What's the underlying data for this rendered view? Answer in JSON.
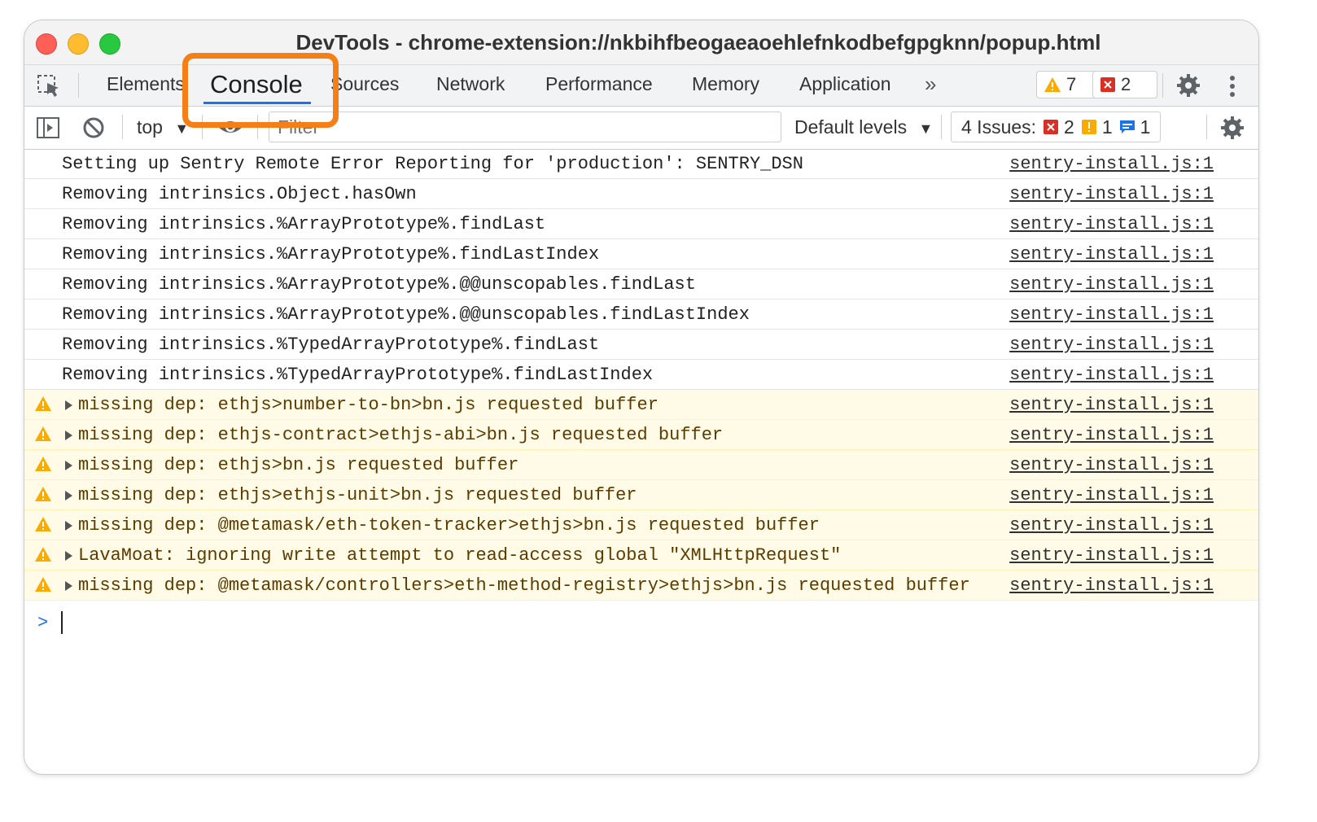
{
  "window": {
    "title": "DevTools - chrome-extension://nkbihfbeogaeaoehlefnkodbefgpgknn/popup.html"
  },
  "tabs": [
    {
      "label": "Elements",
      "active": false
    },
    {
      "label": "Console",
      "active": true
    },
    {
      "label": "Sources",
      "active": false
    },
    {
      "label": "Network",
      "active": false
    },
    {
      "label": "Performance",
      "active": false
    },
    {
      "label": "Memory",
      "active": false
    },
    {
      "label": "Application",
      "active": false
    }
  ],
  "header_badges": {
    "warnings": "7",
    "errors": "2"
  },
  "toolbar": {
    "context": "top",
    "filter_placeholder": "Filter",
    "levels": "Default levels",
    "issues_label": "4 Issues:",
    "issues_errors": "2",
    "issues_warnings": "1",
    "issues_info": "1"
  },
  "icons": {
    "inspect": "inspect-element-icon",
    "overflow": "chevron-double-right-icon",
    "settings": "gear-icon",
    "more": "kebab-menu-icon",
    "sidebar": "sidebar-toggle-icon",
    "clear": "clear-console-icon",
    "live": "eye-icon",
    "warning": "warning-triangle-icon",
    "expand": "expand-triangle-icon",
    "prompt": "chevron-right-icon"
  },
  "colors": {
    "highlight": "#f57f17",
    "active_tab_underline": "#1a73e8",
    "warning_background": "#fffbe6",
    "warning_text": "#5c3b00",
    "error_red": "#d93025",
    "warning_yellow": "#f9ab00",
    "info_blue": "#1a73e8"
  },
  "messages": [
    {
      "level": "log",
      "text": "Setting up Sentry Remote Error Reporting for 'production': SENTRY_DSN",
      "source": "sentry-install.js:1"
    },
    {
      "level": "log",
      "text": "Removing intrinsics.Object.hasOwn",
      "source": "sentry-install.js:1"
    },
    {
      "level": "log",
      "text": "Removing intrinsics.%ArrayPrototype%.findLast",
      "source": "sentry-install.js:1"
    },
    {
      "level": "log",
      "text": "Removing intrinsics.%ArrayPrototype%.findLastIndex",
      "source": "sentry-install.js:1"
    },
    {
      "level": "log",
      "text": "Removing intrinsics.%ArrayPrototype%.@@unscopables.findLast",
      "source": "sentry-install.js:1"
    },
    {
      "level": "log",
      "text": "Removing intrinsics.%ArrayPrototype%.@@unscopables.findLastIndex",
      "source": "sentry-install.js:1"
    },
    {
      "level": "log",
      "text": "Removing intrinsics.%TypedArrayPrototype%.findLast",
      "source": "sentry-install.js:1"
    },
    {
      "level": "log",
      "text": "Removing intrinsics.%TypedArrayPrototype%.findLastIndex",
      "source": "sentry-install.js:1"
    },
    {
      "level": "warn",
      "text": "missing dep: ethjs>number-to-bn>bn.js requested buffer",
      "source": "sentry-install.js:1"
    },
    {
      "level": "warn",
      "text": "missing dep: ethjs-contract>ethjs-abi>bn.js requested buffer",
      "source": "sentry-install.js:1"
    },
    {
      "level": "warn",
      "text": "missing dep: ethjs>bn.js requested buffer",
      "source": "sentry-install.js:1"
    },
    {
      "level": "warn",
      "text": "missing dep: ethjs>ethjs-unit>bn.js requested buffer",
      "source": "sentry-install.js:1"
    },
    {
      "level": "warn",
      "text": "missing dep: @metamask/eth-token-tracker>ethjs>bn.js requested buffer",
      "source": "sentry-install.js:1"
    },
    {
      "level": "warn",
      "text": "LavaMoat: ignoring write attempt to read-access global \"XMLHttpRequest\"",
      "source": "sentry-install.js:1"
    },
    {
      "level": "warn",
      "text": "missing dep: @metamask/controllers>eth-method-registry>ethjs>bn.js requested buffer",
      "source": "sentry-install.js:1"
    }
  ]
}
